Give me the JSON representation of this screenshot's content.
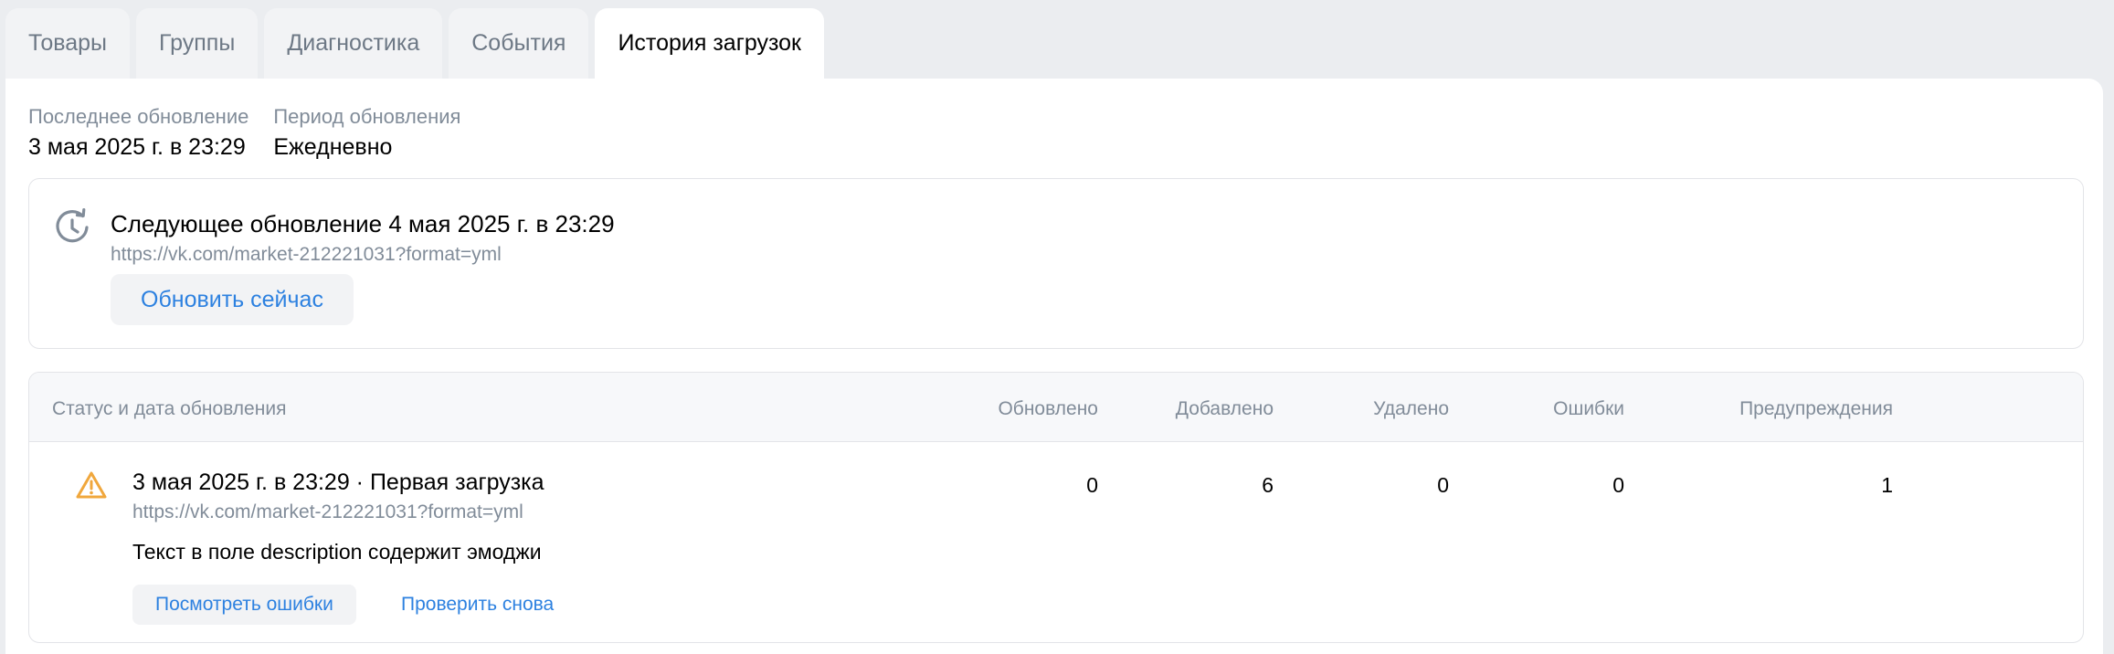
{
  "tabs": [
    {
      "label": "Товары",
      "active": false
    },
    {
      "label": "Группы",
      "active": false
    },
    {
      "label": "Диагностика",
      "active": false
    },
    {
      "label": "События",
      "active": false
    },
    {
      "label": "История загрузок",
      "active": true
    }
  ],
  "meta": {
    "last_update_label": "Последнее обновление",
    "last_update_value": "3 мая 2025 г. в 23:29",
    "period_label": "Период обновления",
    "period_value": "Ежедневно"
  },
  "next_update": {
    "icon": "clock-refresh-icon",
    "title": "Следующее обновление 4 мая 2025 г. в 23:29",
    "url": "https://vk.com/market-212221031?format=yml",
    "refresh_button": "Обновить сейчас"
  },
  "history": {
    "columns": {
      "status": "Статус и дата обновления",
      "updated": "Обновлено",
      "added": "Добавлено",
      "deleted": "Удалено",
      "errors": "Ошибки",
      "warnings": "Предупреждения"
    },
    "rows": [
      {
        "icon": "warning-icon",
        "title": "3 мая 2025 г. в 23:29 · Первая загрузка",
        "url": "https://vk.com/market-212221031?format=yml",
        "updated": "0",
        "added": "6",
        "deleted": "0",
        "errors": "0",
        "warnings": "1",
        "description": "Текст в поле description содержит эмоджи",
        "view_errors_button": "Посмотреть ошибки",
        "recheck_button": "Проверить снова"
      }
    ]
  },
  "colors": {
    "accent": "#2d81e0",
    "warning": "#f0a73c",
    "muted_text": "#818c99",
    "page_background": "#ebedf0"
  }
}
